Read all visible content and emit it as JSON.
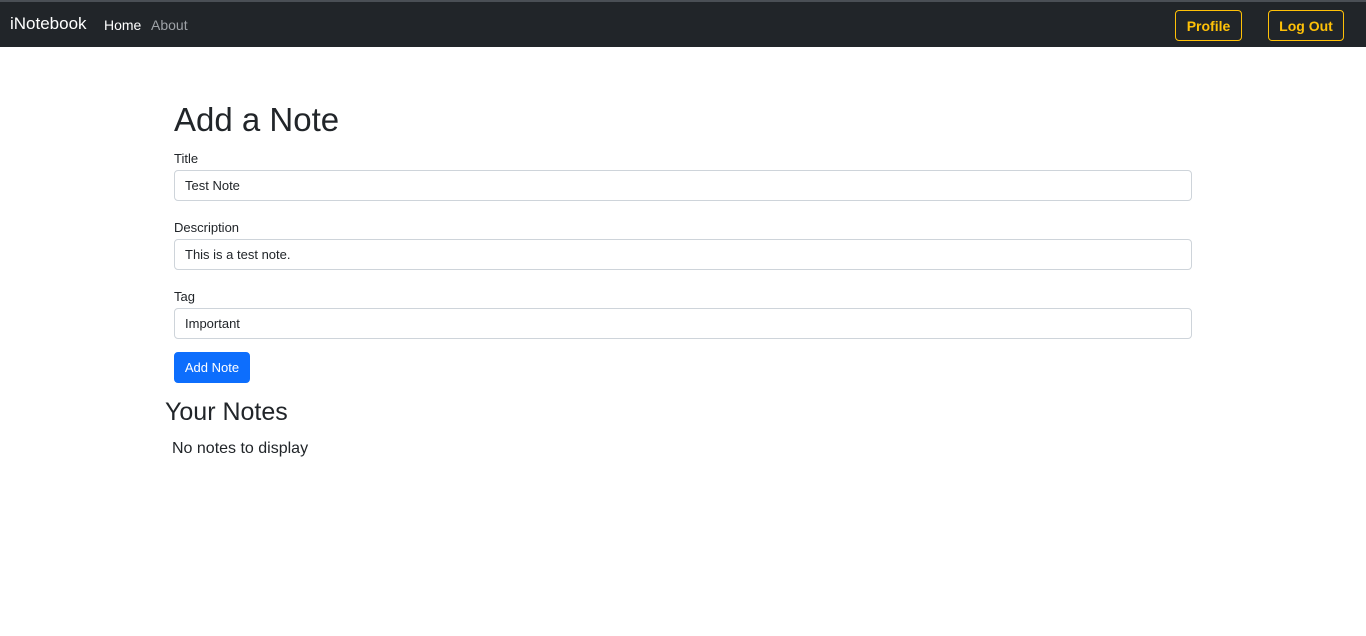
{
  "navbar": {
    "brand": "iNotebook",
    "links": [
      {
        "label": "Home",
        "active": true
      },
      {
        "label": "About",
        "active": false
      }
    ],
    "profile_label": "Profile",
    "logout_label": "Log Out"
  },
  "form": {
    "heading": "Add a Note",
    "title": {
      "label": "Title",
      "value": "Test Note"
    },
    "description": {
      "label": "Description",
      "value": "This is a test note."
    },
    "tag": {
      "label": "Tag",
      "value": "Important"
    },
    "submit_label": "Add Note"
  },
  "notes": {
    "heading": "Your Notes",
    "empty_message": "No notes to display"
  },
  "colors": {
    "navbar_bg": "#212529",
    "warning": "#ffc107",
    "primary": "#0d6efd"
  }
}
